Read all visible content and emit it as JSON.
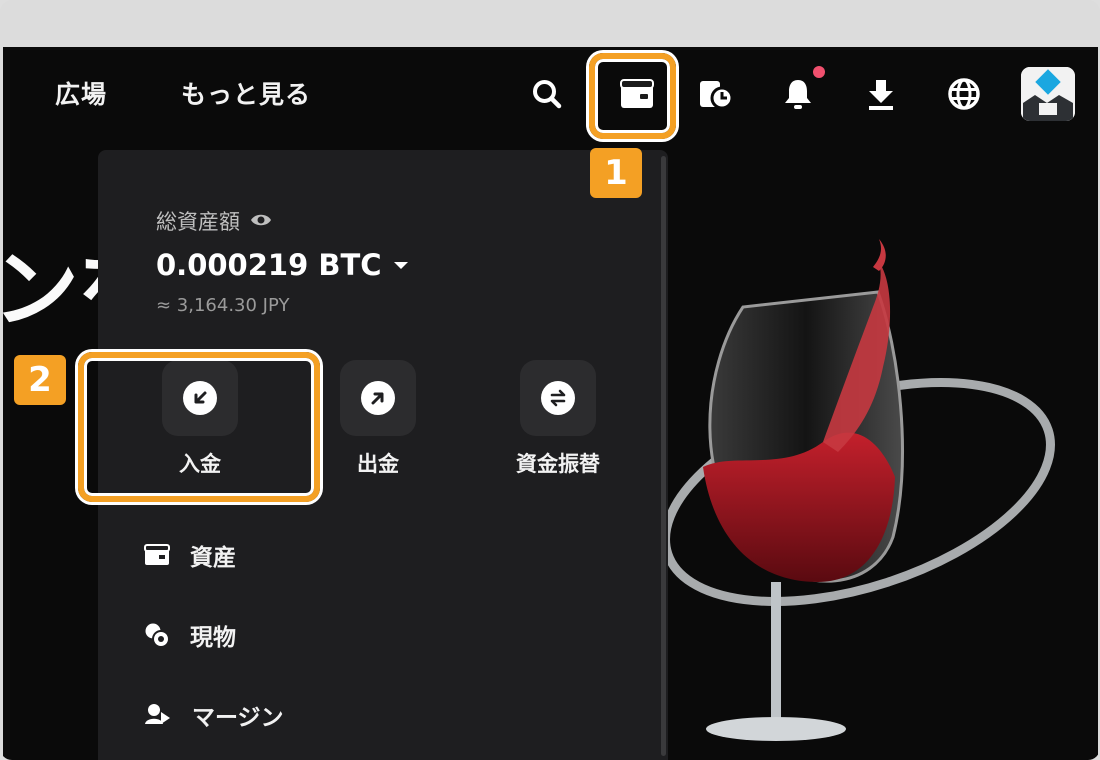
{
  "nav": {
    "links": [
      "広場",
      "もっと見る"
    ],
    "icons": [
      "search-icon",
      "wallet-icon",
      "order-history-icon",
      "notification-bell-icon",
      "download-icon",
      "globe-icon"
    ],
    "notification_dot_color": "#f0506e"
  },
  "hero": {
    "partial_text": "ンを"
  },
  "assets_panel": {
    "total_label": "総資産額",
    "balance": "0.000219 BTC",
    "fiat_value": "≈ 3,164.30 JPY",
    "actions": [
      {
        "label": "入金",
        "icon": "deposit-arrow-icon"
      },
      {
        "label": "出金",
        "icon": "withdraw-arrow-icon"
      },
      {
        "label": "資金振替",
        "icon": "transfer-icon"
      }
    ],
    "menu": [
      {
        "label": "資産",
        "icon": "wallet-icon"
      },
      {
        "label": "現物",
        "icon": "spot-coins-icon"
      },
      {
        "label": "マージン",
        "icon": "margin-icon"
      }
    ]
  },
  "annotations": {
    "step1": "1",
    "step2": "2",
    "accent_color": "#f4a024"
  }
}
